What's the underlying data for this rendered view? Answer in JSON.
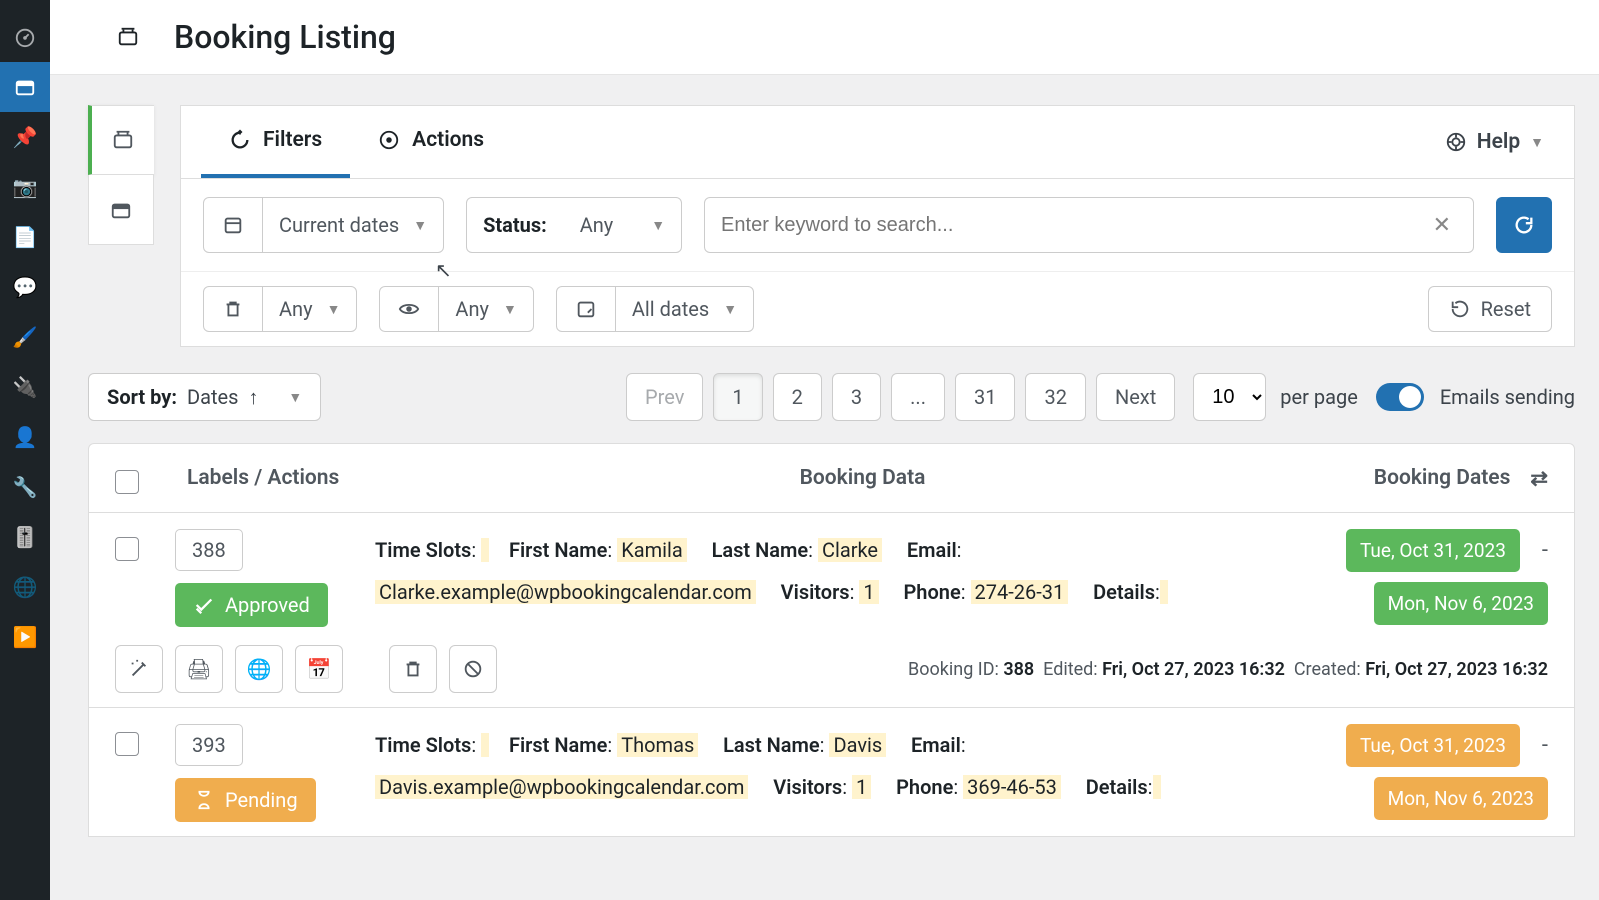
{
  "page": {
    "title": "Booking Listing"
  },
  "tabs": {
    "filters": "Filters",
    "actions": "Actions",
    "help": "Help"
  },
  "filters": {
    "dates": "Current dates",
    "status_label": "Status:",
    "status_value": "Any",
    "search_placeholder": "Enter keyword to search...",
    "trash_any": "Any",
    "visibility_any": "Any",
    "date_range": "All dates",
    "reset": "Reset"
  },
  "sort": {
    "label": "Sort by:",
    "value": "Dates"
  },
  "pagination": {
    "prev": "Prev",
    "next": "Next",
    "pages": [
      "1",
      "2",
      "3",
      "...",
      "31",
      "32"
    ],
    "active": "1",
    "per_page": "10",
    "per_page_label": "per page"
  },
  "emails_toggle": "Emails sending",
  "columns": {
    "labels": "Labels / Actions",
    "data": "Booking Data",
    "dates": "Booking Dates"
  },
  "rows": [
    {
      "id": "388",
      "status": "Approved",
      "status_kind": "approved",
      "fields": {
        "time_slots": "",
        "first_name": "Kamila",
        "last_name": "Clarke",
        "email": "Clarke.example@wpbookingcalendar.com",
        "visitors": "1",
        "phone": "274-26-31",
        "details": ""
      },
      "labels": {
        "time_slots": "Time Slots",
        "first_name": "First Name",
        "last_name": "Last Name",
        "email": "Email",
        "visitors": "Visitors",
        "phone": "Phone",
        "details": "Details"
      },
      "date_start": "Tue, Oct 31, 2023",
      "date_end": "Mon, Nov 6, 2023",
      "date_color": "green",
      "meta": {
        "id_label": "Booking ID:",
        "id": "388",
        "edited_label": "Edited:",
        "edited": "Fri, Oct 27, 2023 16:32",
        "created_label": "Created:",
        "created": "Fri, Oct 27, 2023 16:32"
      }
    },
    {
      "id": "393",
      "status": "Pending",
      "status_kind": "pending",
      "fields": {
        "time_slots": "",
        "first_name": "Thomas",
        "last_name": "Davis",
        "email": "Davis.example@wpbookingcalendar.com",
        "visitors": "1",
        "phone": "369-46-53",
        "details": ""
      },
      "labels": {
        "time_slots": "Time Slots",
        "first_name": "First Name",
        "last_name": "Last Name",
        "email": "Email",
        "visitors": "Visitors",
        "phone": "Phone",
        "details": "Details"
      },
      "date_start": "Tue, Oct 31, 2023",
      "date_end": "Mon, Nov 6, 2023",
      "date_color": "orange"
    }
  ]
}
